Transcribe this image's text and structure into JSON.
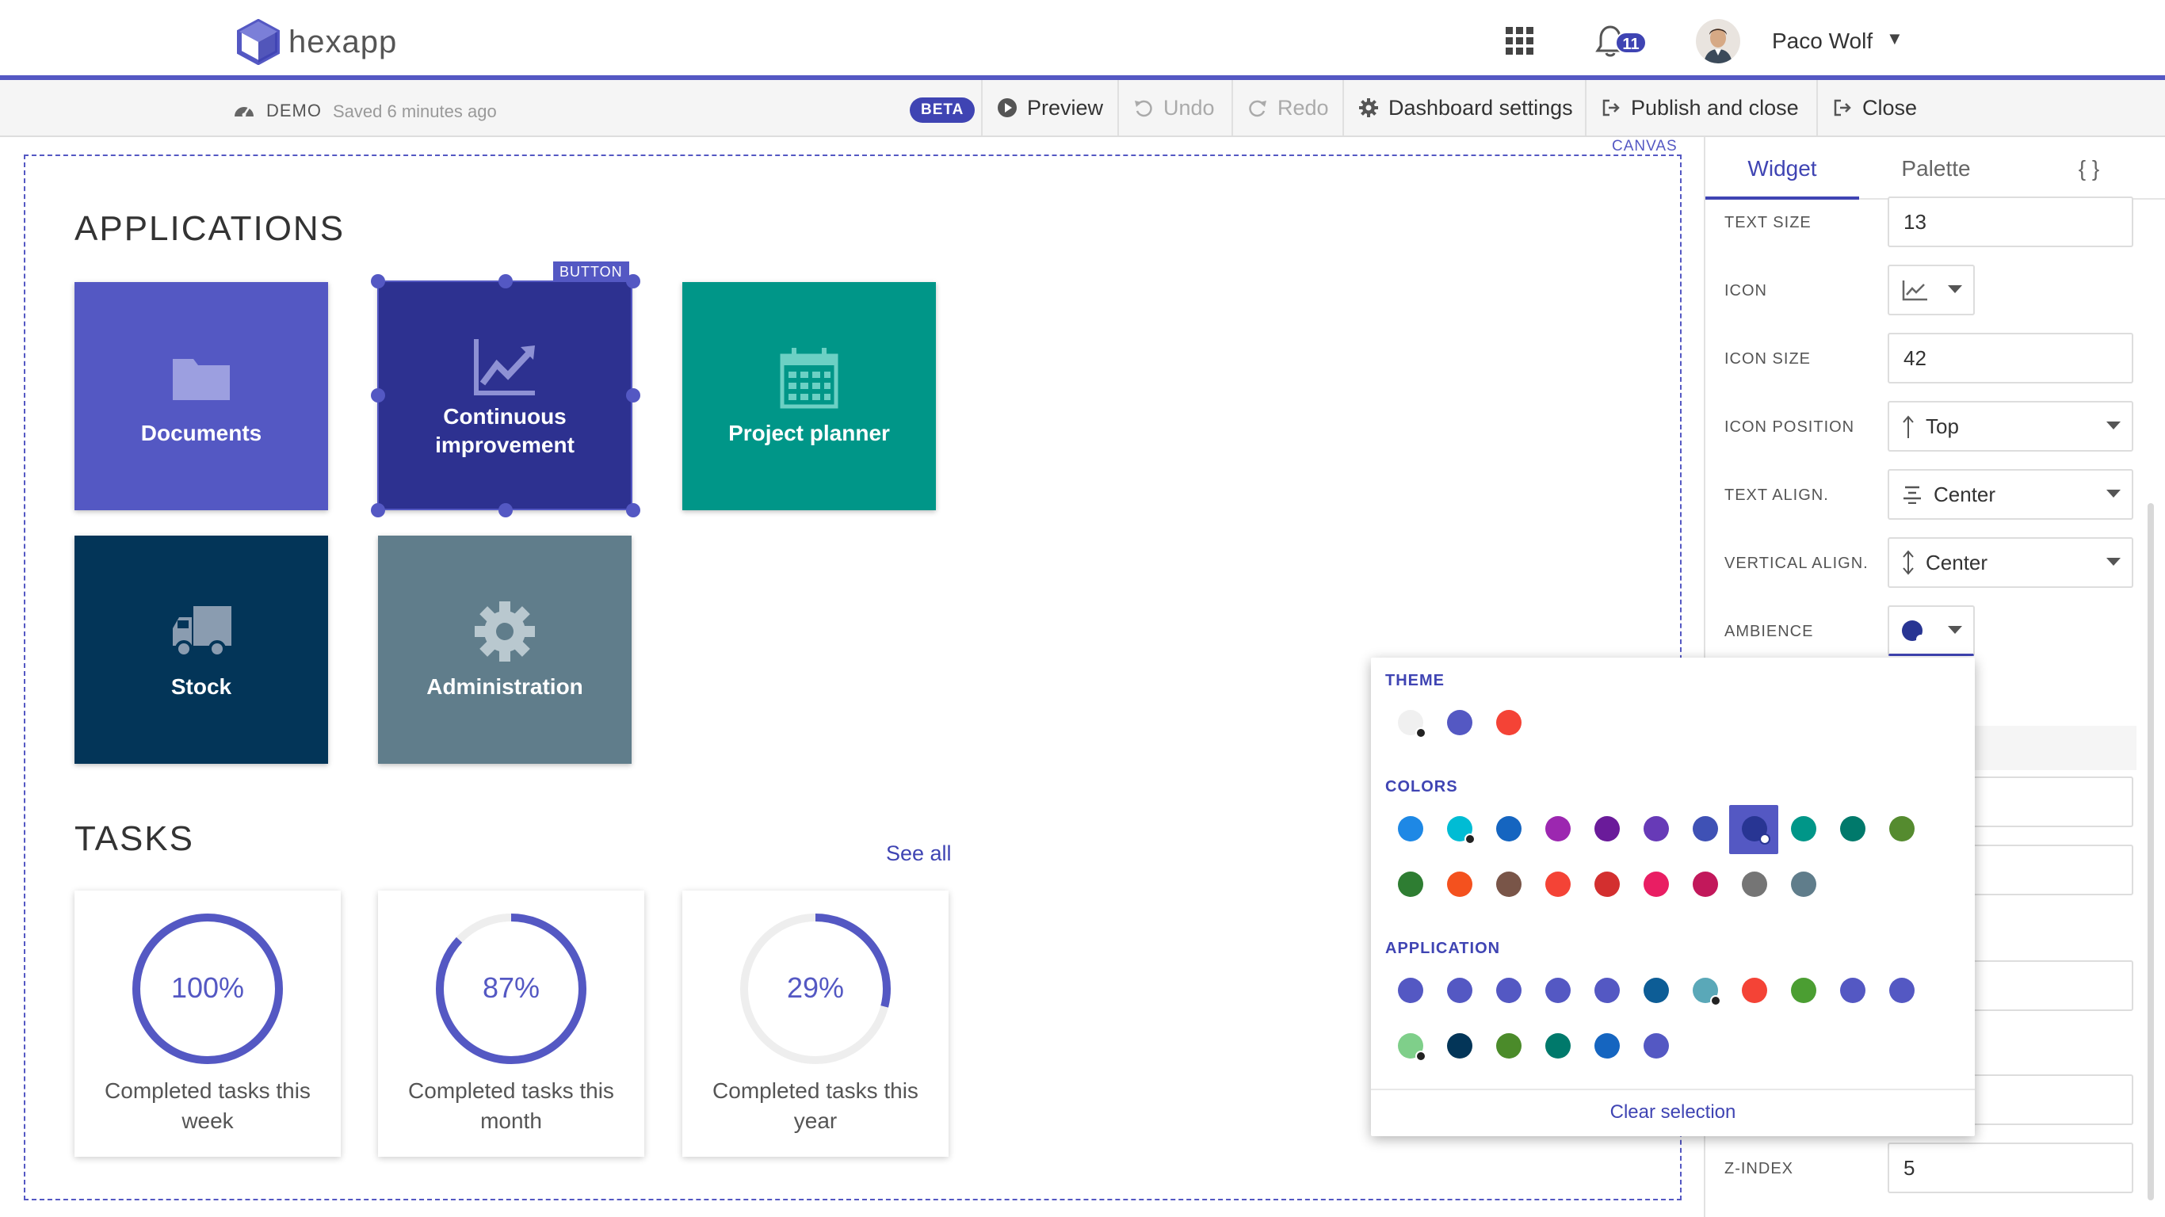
{
  "header": {
    "app_name": "hexapp",
    "notification_count": "11",
    "user_name": "Paco Wolf"
  },
  "toolbar": {
    "mode": "DEMO",
    "saved": "Saved 6 minutes ago",
    "beta": "BETA",
    "preview": "Preview",
    "undo": "Undo",
    "redo": "Redo",
    "dashboard_settings": "Dashboard settings",
    "publish": "Publish and close",
    "close": "Close"
  },
  "canvas": {
    "tag": "CANVAS",
    "applications_title": "APPLICATIONS",
    "selected_tag": "BUTTON",
    "tiles": [
      {
        "label": "Documents",
        "color": "#5458c3",
        "icon": "folder-icon"
      },
      {
        "label": "Continuous improvement",
        "color": "#2d3190",
        "icon": "chart-line-icon"
      },
      {
        "label": "Project planner",
        "color": "#009688",
        "icon": "calendar-icon"
      },
      {
        "label": "Stock",
        "color": "#033558",
        "icon": "truck-icon"
      },
      {
        "label": "Administration",
        "color": "#607d8b",
        "icon": "gear-icon"
      }
    ],
    "tasks_title": "TASKS",
    "see_all": "See all",
    "tasks": [
      {
        "percent": "100%",
        "value": 100,
        "caption": "Completed tasks this week"
      },
      {
        "percent": "87%",
        "value": 87,
        "caption": "Completed tasks this month"
      },
      {
        "percent": "29%",
        "value": 29,
        "caption": "Completed tasks this year"
      }
    ]
  },
  "panel": {
    "tabs": [
      "Widget",
      "Palette",
      "{ }"
    ],
    "text_size_label": "TEXT SIZE",
    "text_size_value": "13",
    "icon_label": "ICON",
    "icon_size_label": "ICON SIZE",
    "icon_size_value": "42",
    "icon_position_label": "ICON POSITION",
    "icon_position_value": "Top",
    "text_align_label": "TEXT ALIGN.",
    "text_align_value": "Center",
    "vertical_align_label": "VERTICAL ALIGN.",
    "vertical_align_value": "Center",
    "ambience_label": "AMBIENCE",
    "zindex_label": "Z-INDEX",
    "zindex_value": "5"
  },
  "ambience_popover": {
    "theme_title": "THEME",
    "colors_title": "COLORS",
    "application_title": "APPLICATION",
    "clear": "Clear selection",
    "theme": [
      {
        "color": "#f0f0f0",
        "dot": "#222222"
      },
      {
        "color": "#5458c3"
      },
      {
        "color": "#f44336"
      }
    ],
    "colors": [
      {
        "color": "#1e88e5"
      },
      {
        "color": "#00bcd4",
        "dot": "#222222"
      },
      {
        "color": "#1565c0"
      },
      {
        "color": "#9c27b0"
      },
      {
        "color": "#6a1b9a"
      },
      {
        "color": "#673ab7"
      },
      {
        "color": "#3f51b5"
      },
      {
        "color": "#283593",
        "selected": true
      },
      {
        "color": "#009688"
      },
      {
        "color": "#00796b"
      },
      {
        "color": "#558b2f"
      },
      {
        "color": "#2e7d32"
      },
      {
        "color": "#f4511e"
      },
      {
        "color": "#795548"
      },
      {
        "color": "#f44336"
      },
      {
        "color": "#d32f2f"
      },
      {
        "color": "#e91e63"
      },
      {
        "color": "#c2185b"
      },
      {
        "color": "#757575"
      },
      {
        "color": "#607d8b"
      }
    ],
    "application": [
      {
        "color": "#5458c3"
      },
      {
        "color": "#5458c3"
      },
      {
        "color": "#5458c3"
      },
      {
        "color": "#5458c3"
      },
      {
        "color": "#5458c3"
      },
      {
        "color": "#0d5d96"
      },
      {
        "color": "#5aa8b8",
        "dot": "#222222"
      },
      {
        "color": "#f44336"
      },
      {
        "color": "#4b9e32"
      },
      {
        "color": "#5458c3"
      },
      {
        "color": "#5458c3"
      },
      {
        "color": "#7fcf8a",
        "dot": "#222222"
      },
      {
        "color": "#033558"
      },
      {
        "color": "#4b8b2a"
      },
      {
        "color": "#00796b"
      },
      {
        "color": "#1565c0"
      },
      {
        "color": "#5458c3"
      }
    ]
  },
  "colors": {
    "accent": "#5458c3",
    "accent_dark": "#3f44b3"
  }
}
